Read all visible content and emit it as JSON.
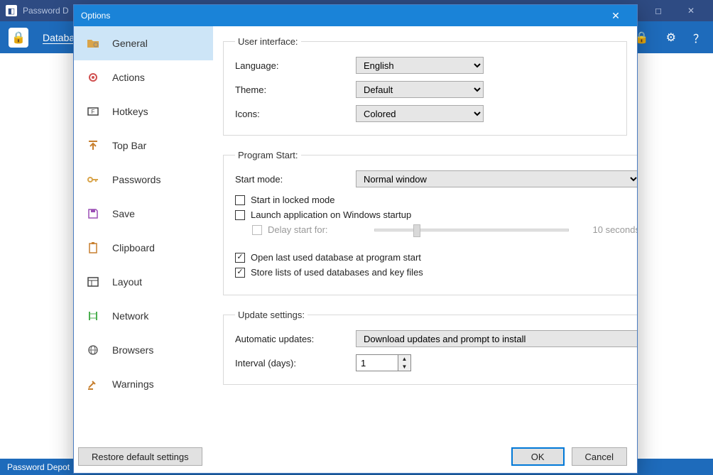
{
  "app": {
    "title": "Password D",
    "menu_database": "Databa",
    "statusbar": "Password Depot"
  },
  "dialog": {
    "title": "Options",
    "restore": "Restore default settings",
    "ok": "OK",
    "cancel": "Cancel"
  },
  "sidebar": {
    "items": [
      {
        "label": "General"
      },
      {
        "label": "Actions"
      },
      {
        "label": "Hotkeys"
      },
      {
        "label": "Top Bar"
      },
      {
        "label": "Passwords"
      },
      {
        "label": "Save"
      },
      {
        "label": "Clipboard"
      },
      {
        "label": "Layout"
      },
      {
        "label": "Network"
      },
      {
        "label": "Browsers"
      },
      {
        "label": "Warnings"
      }
    ]
  },
  "ui": {
    "legend": "User interface:",
    "language_label": "Language:",
    "language_value": "English",
    "theme_label": "Theme:",
    "theme_value": "Default",
    "icons_label": "Icons:",
    "icons_value": "Colored"
  },
  "start": {
    "legend": "Program Start:",
    "mode_label": "Start mode:",
    "mode_value": "Normal window",
    "locked": "Start in locked mode",
    "launch": "Launch application on Windows startup",
    "delay_label": "Delay start for:",
    "delay_value": "10 seconds",
    "open_last": "Open last used database at program start",
    "store_lists": "Store lists of used databases and key files"
  },
  "update": {
    "legend": "Update settings:",
    "auto_label": "Automatic updates:",
    "auto_value": "Download updates and prompt to install",
    "interval_label": "Interval (days):",
    "interval_value": "1"
  }
}
